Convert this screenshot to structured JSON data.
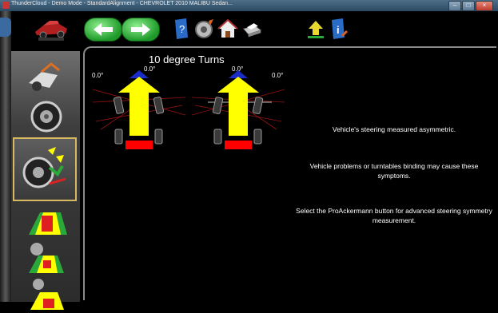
{
  "window": {
    "title": "ThunderCloud - Demo Mode - StandardAlignment - CHEVROLET 2010 MALIBU Sedan..."
  },
  "toolbar": {
    "icons": [
      "back-arrow-icon",
      "forward-arrow-icon",
      "help-icon",
      "wheel-settings-icon",
      "home-icon",
      "print-icon",
      "upload-icon",
      "info-icon"
    ]
  },
  "main": {
    "title": "10 degree Turns",
    "left_diagram": {
      "left_angle": "0.0°",
      "center_angle": "0.0°"
    },
    "right_diagram": {
      "center_angle": "0.0°",
      "right_angle": "0.0°"
    },
    "messages": [
      "Vehicle's steering measured asymmetric.",
      "Vehicle problems or turntables binding may cause these symptoms.",
      "Select the ProAckermann button for advanced steering symmetry measurement."
    ]
  },
  "colors": {
    "arrow_yellow": "#ffff00",
    "bar_red": "#ff0000",
    "tip_blue": "#1a2cc8",
    "button_green": "#2aa83a",
    "highlight_gold": "#d8b860"
  }
}
